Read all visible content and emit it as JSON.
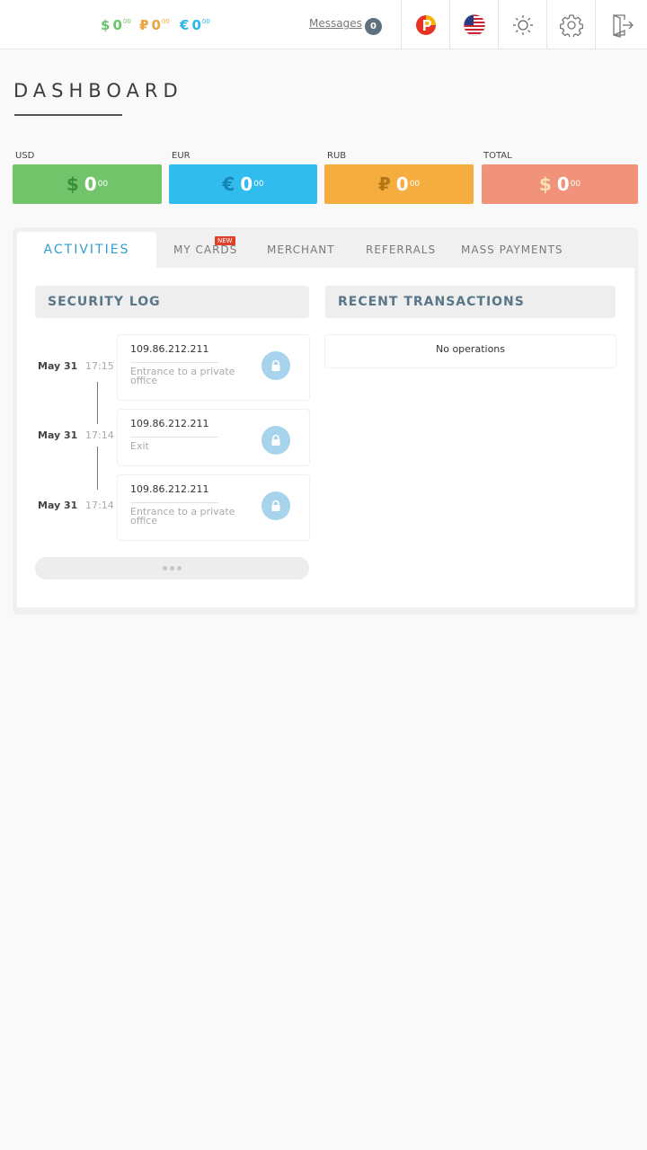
{
  "header": {
    "balances": {
      "usd": {
        "symbol": "$",
        "value": "0",
        "cents": "00",
        "color": "#6cc36a"
      },
      "rub": {
        "symbol": "₽",
        "value": "0",
        "cents": "00",
        "color": "#e9a53d"
      },
      "eur": {
        "symbol": "€",
        "value": "0",
        "cents": "00",
        "color": "#2cb6e8"
      }
    },
    "messages_label": "Messages",
    "messages_count": "0",
    "icons": [
      "payeer-logo-icon",
      "us-flag-icon",
      "brightness-icon",
      "gear-icon",
      "logout-icon"
    ]
  },
  "page": {
    "title": "DASHBOARD"
  },
  "cards": {
    "usd": {
      "label": "USD",
      "symbol": "$",
      "value": "0",
      "cents": "00",
      "color": "#72c46a"
    },
    "eur": {
      "label": "EUR",
      "symbol": "€",
      "value": "0",
      "cents": "00",
      "color": "#30bdee"
    },
    "rub": {
      "label": "RUB",
      "symbol": "₽",
      "value": "0",
      "cents": "00",
      "color": "#f4ad3e"
    },
    "total": {
      "label": "TOTAL",
      "symbol": "$",
      "value": "0",
      "cents": "00",
      "color": "#f0937a"
    }
  },
  "tabs": {
    "activities": "ACTIVITIES",
    "my_cards": "MY CARDS",
    "my_cards_badge": "NEW",
    "merchant": "MERCHANT",
    "referrals": "REFERRALS",
    "mass_payments": "MASS PAYMENTS",
    "active": "activities"
  },
  "security_log": {
    "title": "SECURITY LOG",
    "entries": [
      {
        "date": "May 31",
        "time": "17:15",
        "ip": "109.86.212.211",
        "event": "Entrance to a private office",
        "icon": "lock-icon"
      },
      {
        "date": "May 31",
        "time": "17:14",
        "ip": "109.86.212.211",
        "event": "Exit",
        "icon": "lock-icon"
      },
      {
        "date": "May 31",
        "time": "17:14",
        "ip": "109.86.212.211",
        "event": "Entrance to a private office",
        "icon": "lock-icon"
      }
    ]
  },
  "recent_transactions": {
    "title": "RECENT TRANSACTIONS",
    "empty_text": "No operations"
  }
}
